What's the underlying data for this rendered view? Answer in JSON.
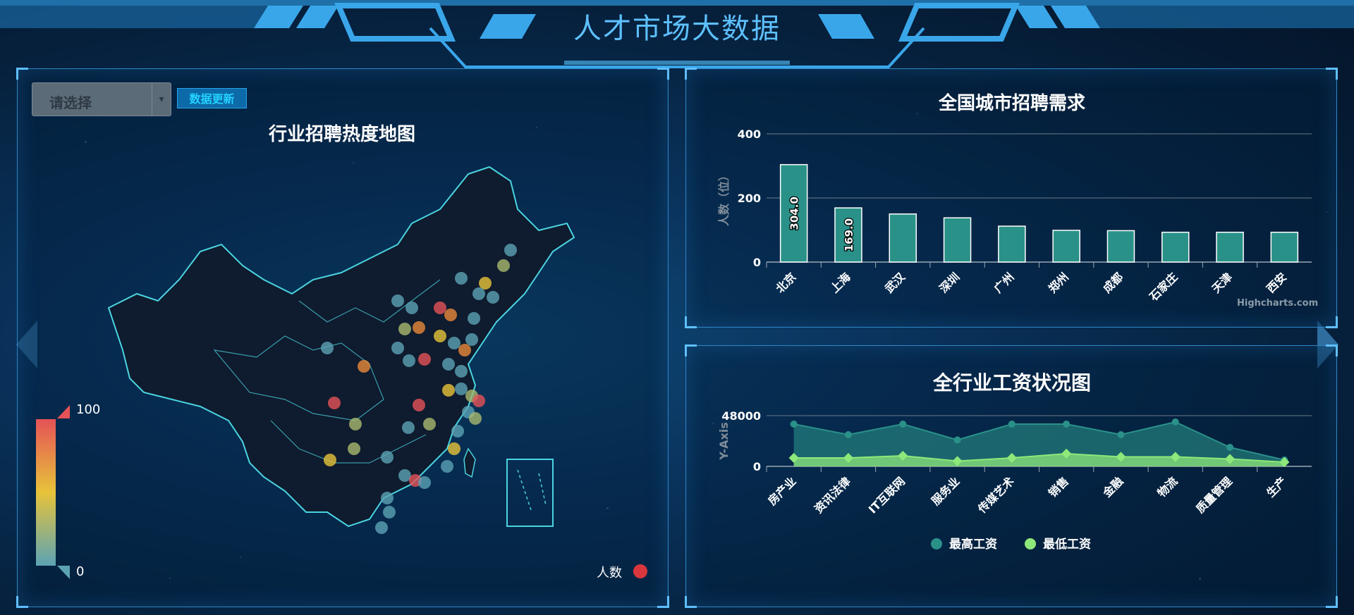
{
  "page": {
    "title": "人才市场大数据"
  },
  "map_panel": {
    "select": {
      "value": "请选择"
    },
    "update_button": "数据更新",
    "title": "行业招聘热度地图",
    "legend_max": "100",
    "legend_min": "0",
    "series_label": "人数",
    "colors": {
      "low": "#5ba3b4",
      "mid": "#e7c33a",
      "high": "#e55257"
    }
  },
  "city_chart": {
    "credits": "Highcharts.com",
    "chart_data": {
      "type": "bar",
      "title": "全国城市招聘需求",
      "ylabel": "人数（位）",
      "xlabel": "",
      "categories": [
        "北京",
        "上海",
        "武汉",
        "深圳",
        "广州",
        "郑州",
        "成都",
        "石家庄",
        "天津",
        "西安"
      ],
      "values": [
        304.0,
        169.0,
        150,
        138,
        112,
        99,
        98,
        93,
        93,
        93
      ],
      "data_labels": [
        "304.0",
        "169.0"
      ],
      "ylim": [
        0,
        400
      ],
      "yticks": [
        "0",
        "200",
        "400"
      ],
      "bar_color": "#2a9189",
      "grid": true
    }
  },
  "salary_chart": {
    "chart_data": {
      "type": "area",
      "title": "全行业工资状况图",
      "ylabel": "Y-Axis",
      "xlabel": "",
      "categories": [
        "房产业",
        "资讯法律",
        "IT互联网",
        "服务业",
        "传媒艺术",
        "销售",
        "金融",
        "物流",
        "质量管理",
        "生产"
      ],
      "ylim": [
        0,
        48000
      ],
      "yticks": [
        "0",
        "48000"
      ],
      "series": [
        {
          "name": "最高工资",
          "color": "#2a9189",
          "values": [
            40000,
            30000,
            40000,
            25000,
            40000,
            40000,
            30000,
            42000,
            18000,
            6000
          ]
        },
        {
          "name": "最低工资",
          "color": "#8ee87a",
          "values": [
            8000,
            8000,
            10000,
            5000,
            8000,
            12000,
            9000,
            9000,
            7000,
            4000
          ]
        }
      ],
      "legend_position": "bottom-center",
      "grid": true
    }
  }
}
